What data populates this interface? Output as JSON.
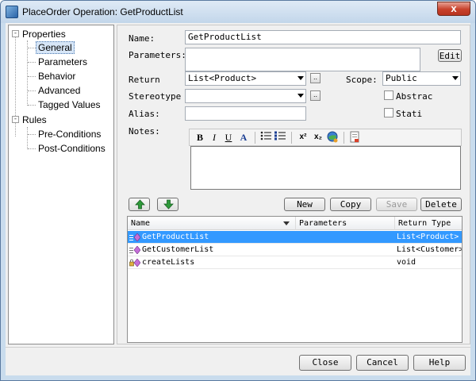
{
  "window": {
    "title": "PlaceOrder Operation: GetProductList",
    "close_glyph": "x"
  },
  "tree": {
    "groups": [
      {
        "label": "Properties",
        "expander": "-",
        "items": [
          "General",
          "Parameters",
          "Behavior",
          "Advanced",
          "Tagged Values"
        ],
        "selected": "General"
      },
      {
        "label": "Rules",
        "expander": "-",
        "items": [
          "Pre-Conditions",
          "Post-Conditions"
        ]
      }
    ]
  },
  "form": {
    "name_label": "Name:",
    "name_value": "GetProductList",
    "parameters_label": "Parameters:",
    "parameters_value": "",
    "edit_button": "Edit",
    "return_label": "Return",
    "return_value": "List<Product>",
    "return_more": "..",
    "scope_label": "Scope:",
    "scope_value": "Public",
    "stereotype_label": "Stereotype",
    "stereotype_value": "",
    "stereotype_more": "..",
    "abstract_label": "Abstrac",
    "static_label": "Stati",
    "alias_label": "Alias:",
    "alias_value": "",
    "notes_label": "Notes:",
    "notes_value": ""
  },
  "notes_toolbar": {
    "bold": "B",
    "italic": "I",
    "underline": "U",
    "font_color": "A",
    "superscript": "x²",
    "subscript": "x₂"
  },
  "actions": {
    "new": "New",
    "copy": "Copy",
    "save": "Save",
    "delete": "Delete"
  },
  "operations_list": {
    "columns": [
      "Name",
      "Parameters",
      "Return Type"
    ],
    "rows": [
      {
        "name": "GetProductList",
        "parameters": "",
        "return_type": "List<Product>",
        "selected": true
      },
      {
        "name": "GetCustomerList",
        "parameters": "",
        "return_type": "List<Customer>",
        "selected": false
      },
      {
        "name": "createLists",
        "parameters": "",
        "return_type": "void",
        "selected": false
      }
    ]
  },
  "footer": {
    "close": "Close",
    "cancel": "Cancel",
    "help": "Help"
  },
  "colors": {
    "selection": "#3399ff",
    "up_arrow": "#2e9a3a",
    "down_arrow": "#2e9a3a"
  }
}
